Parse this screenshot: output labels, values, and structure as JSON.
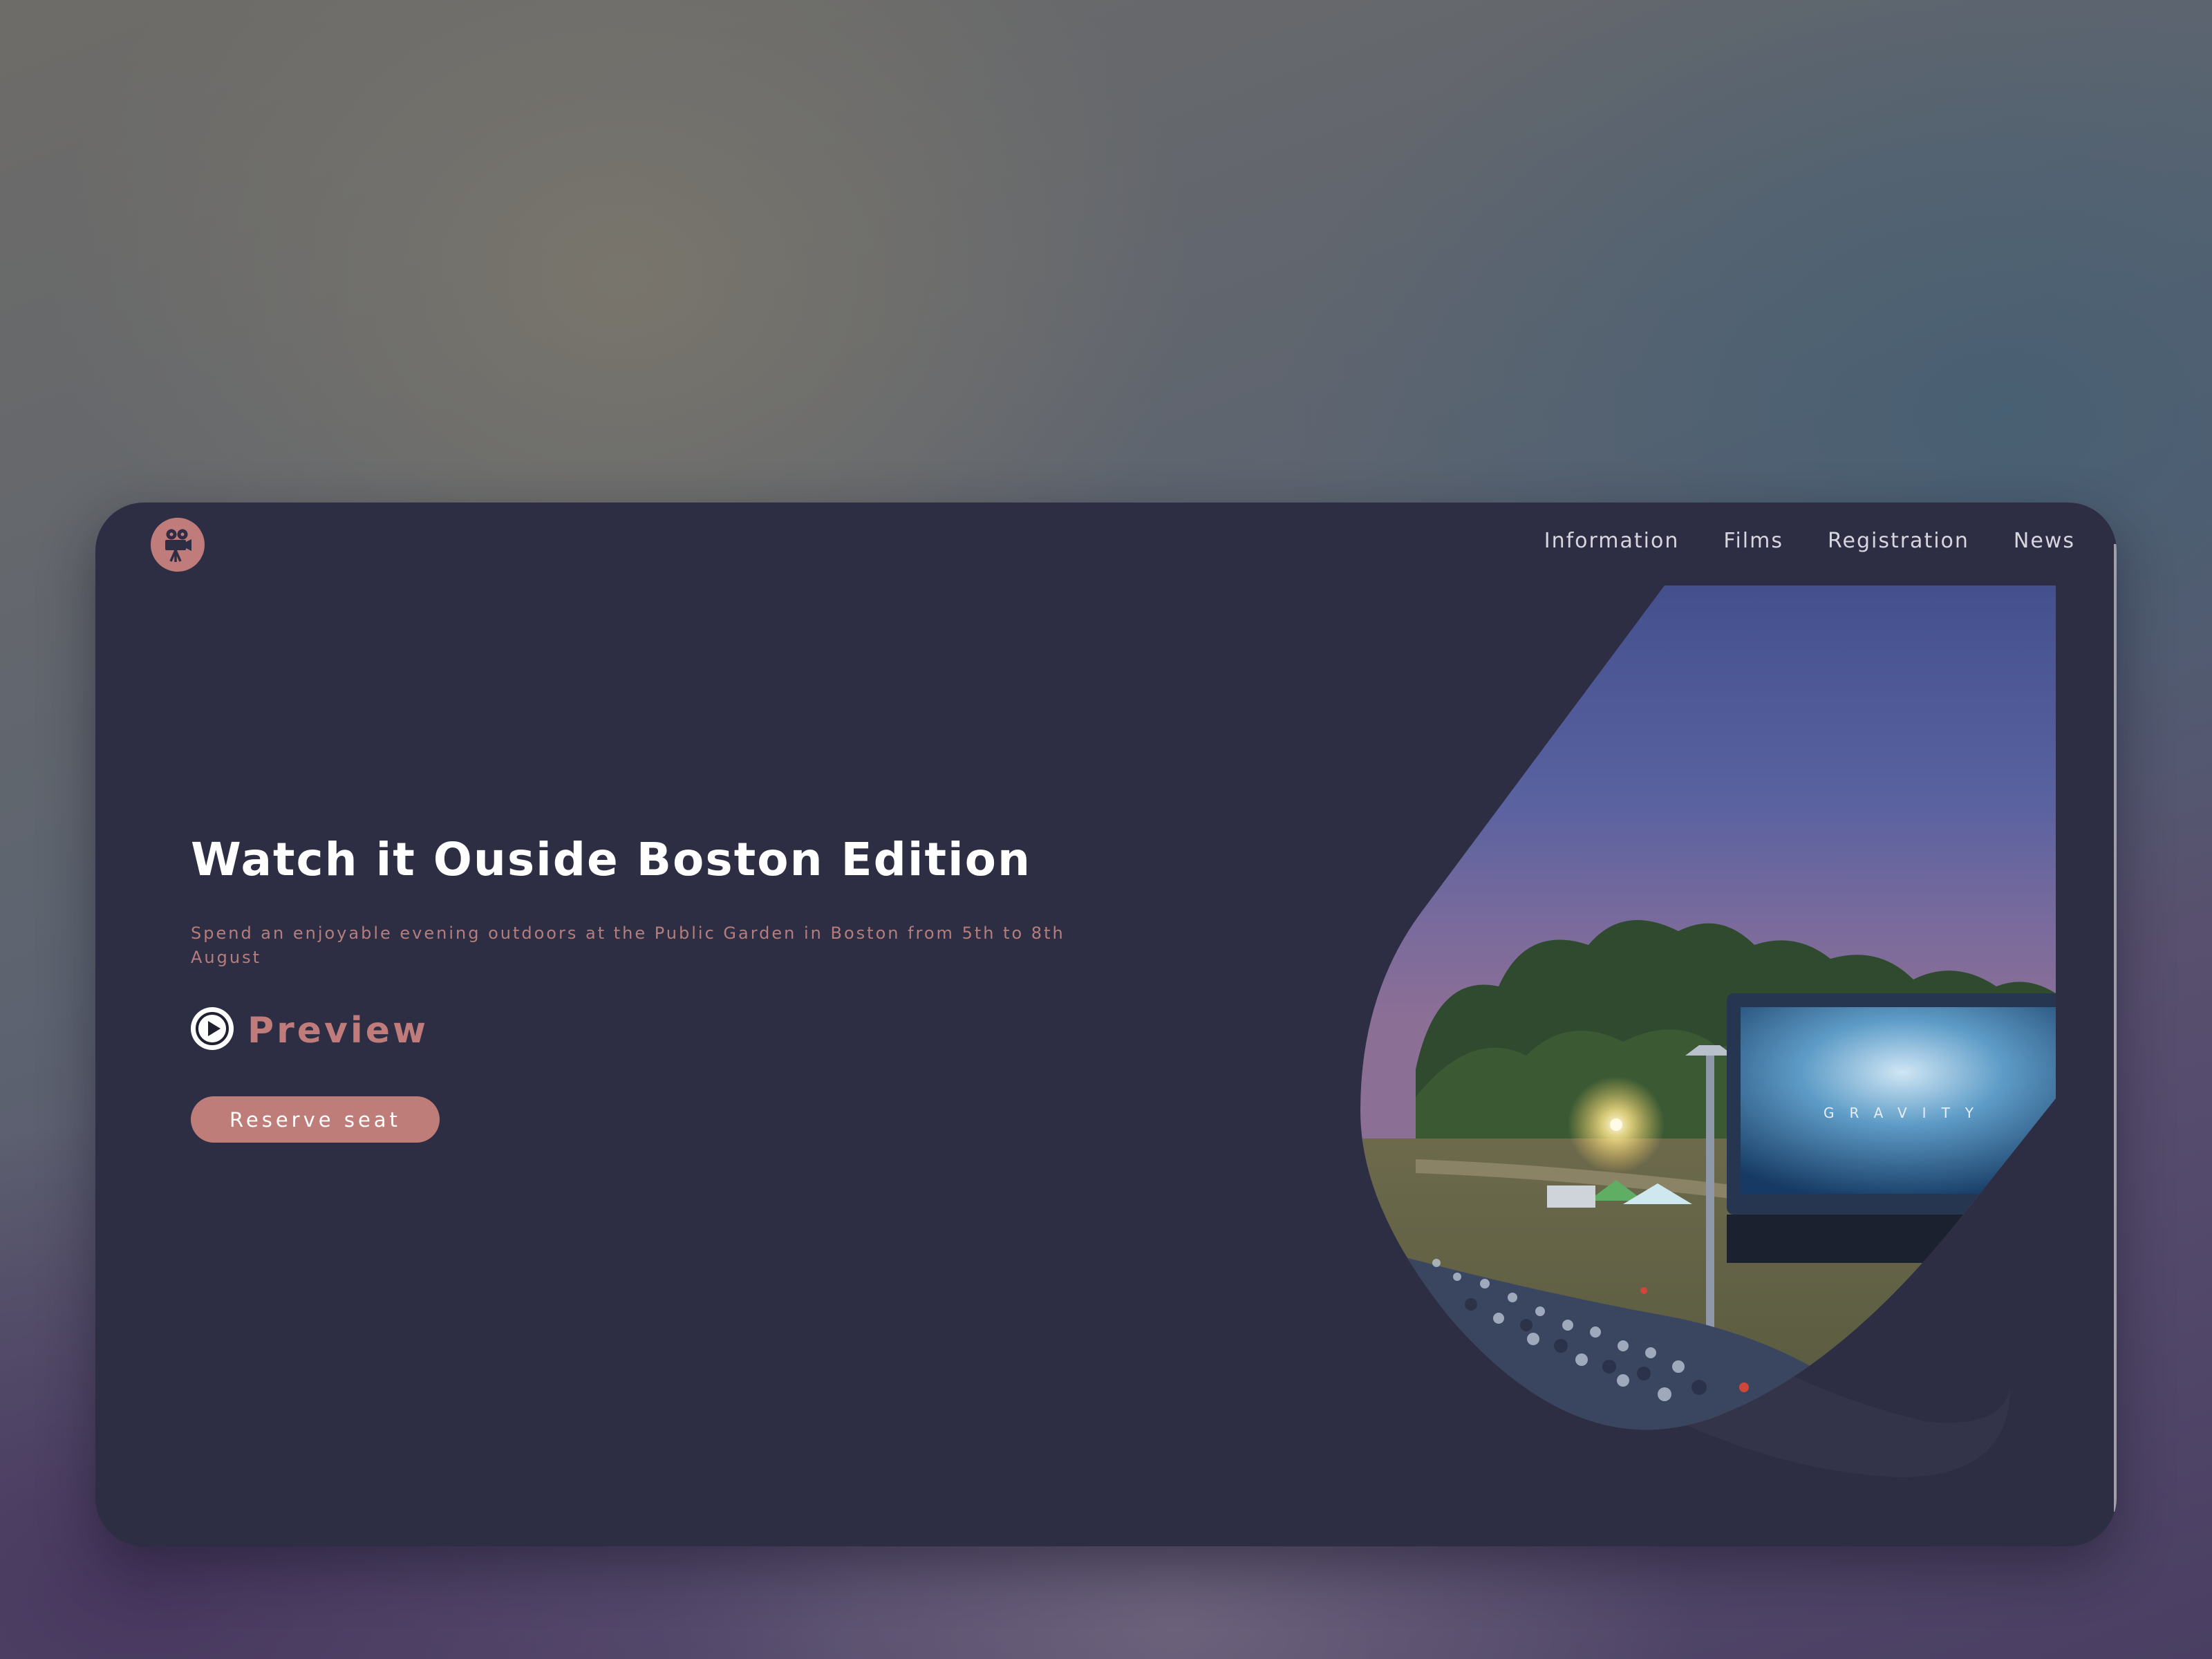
{
  "brand": {
    "logo_icon": "movie-camera-icon",
    "accent_color": "#c07c7a"
  },
  "nav": {
    "items": [
      {
        "label": "Information"
      },
      {
        "label": "Films"
      },
      {
        "label": "Registration"
      },
      {
        "label": "News"
      }
    ]
  },
  "hero": {
    "title": "Watch it Ouside Boston Edition",
    "subtitle": "Spend an enjoyable evening outdoors at the Public Garden in Boston from 5th to 8th August",
    "preview_label": "Preview",
    "preview_icon": "play-icon",
    "reserve_label": "Reserve seat",
    "screen_text": "GRAVITY"
  },
  "colors": {
    "card_bg": "#2d2e44",
    "title": "#ffffff",
    "subtitle": "#b57e7c",
    "nav_text": "#d7d6df"
  }
}
